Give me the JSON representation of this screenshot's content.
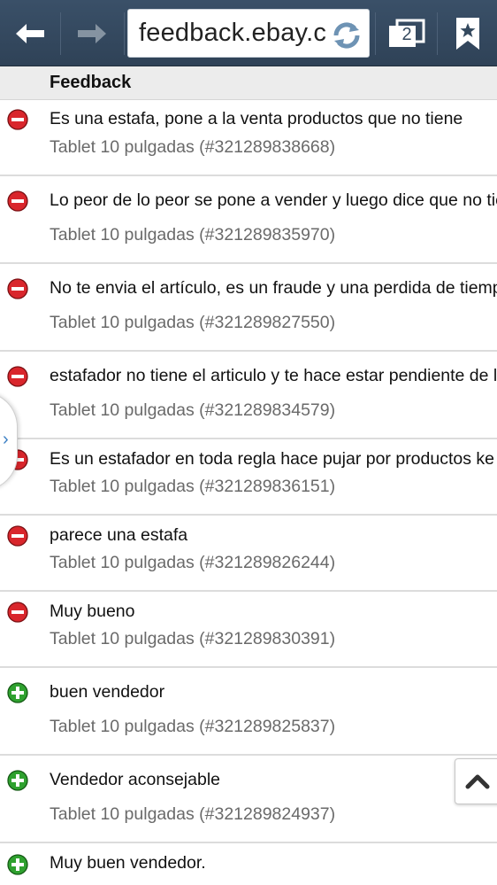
{
  "browser": {
    "url": "feedback.ebay.c",
    "tab_count": "2"
  },
  "section": {
    "title": "Feedback"
  },
  "feedback": [
    {
      "type": "negative",
      "comment": "Es una estafa, pone a la venta productos que no tiene",
      "item": "Tablet 10 pulgadas (#321289838668)"
    },
    {
      "type": "negative",
      "comment": "Lo peor de lo peor se pone a vender y luego dice que no tie",
      "item": "Tablet 10 pulgadas (#321289835970)"
    },
    {
      "type": "negative",
      "comment": "No te envia el artículo, es un fraude y una perdida de tiemp",
      "item": "Tablet 10 pulgadas (#321289827550)"
    },
    {
      "type": "negative",
      "comment": "estafador no tiene el articulo y te hace estar pendiente de l",
      "item": "Tablet 10 pulgadas (#321289834579)"
    },
    {
      "type": "negative",
      "comment": "Es un estafador en toda regla hace pujar por productos ke",
      "item": "Tablet 10 pulgadas (#321289836151)"
    },
    {
      "type": "negative",
      "comment": "parece una estafa",
      "item": "Tablet 10 pulgadas (#321289826244)"
    },
    {
      "type": "negative",
      "comment": "Muy bueno",
      "item": "Tablet 10 pulgadas (#321289830391)"
    },
    {
      "type": "positive",
      "comment": "buen vendedor",
      "item": "Tablet 10 pulgadas (#321289825837)"
    },
    {
      "type": "positive",
      "comment": "Vendedor aconsejable",
      "item": "Tablet 10 pulgadas (#321289824937)"
    },
    {
      "type": "positive",
      "comment": "Muy buen vendedor.",
      "item": ""
    }
  ],
  "colors": {
    "toolbar": "#34495e",
    "negative": "#d9262c",
    "positive": "#2fa12f"
  },
  "icons": {
    "negative": "minus-circle-icon",
    "positive": "plus-circle-icon",
    "back": "back-arrow-icon",
    "forward": "forward-arrow-icon",
    "reload": "reload-icon",
    "tabs": "tabs-icon",
    "bookmark": "bookmark-star-icon",
    "scroll_top": "chevron-up-icon",
    "side_panel": "chevron-right-icon"
  }
}
